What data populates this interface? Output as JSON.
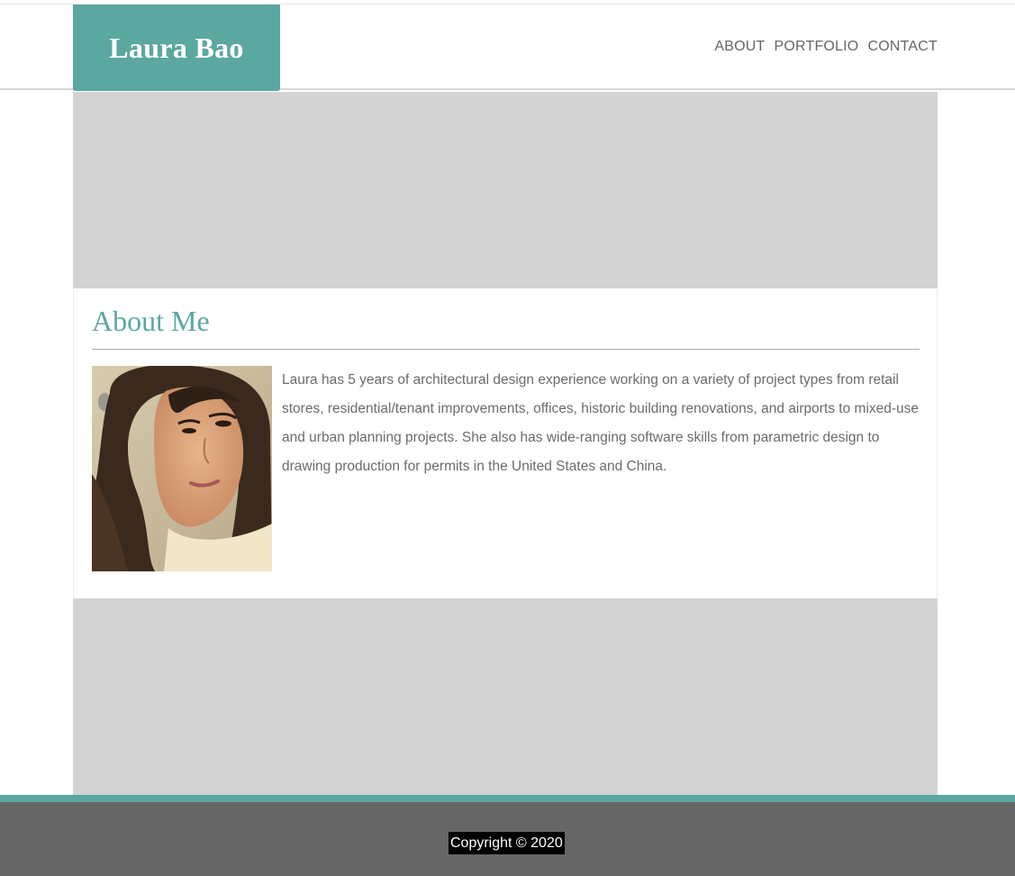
{
  "header": {
    "logo_text": "Laura Bao",
    "nav": [
      {
        "label": "ABOUT"
      },
      {
        "label": "PORTFOLIO"
      },
      {
        "label": "CONTACT"
      }
    ]
  },
  "about": {
    "title": "About Me",
    "photo_alt": "portrait-photo",
    "body": "Laura has 5 years of architectural design experience working on a variety of project types from retail stores, residential/tenant improvements, offices, historic building renovations, and airports to mixed-use and urban planning projects. She also has wide-ranging software skills from parametric design to drawing production for permits in the United States and China."
  },
  "footer": {
    "copyright": "Copyright © 2020"
  },
  "colors": {
    "accent": "#5ba8a0",
    "block_gray": "#d3d3d3",
    "footer_gray": "#666666",
    "nav_text": "#666666",
    "body_text": "#6b6b6b"
  }
}
